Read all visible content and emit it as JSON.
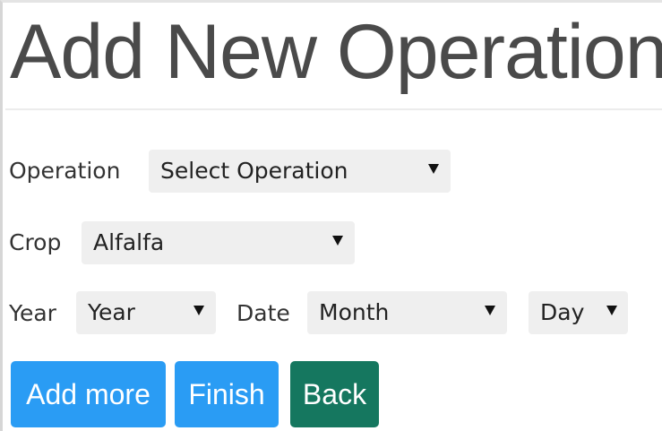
{
  "page": {
    "title": "Add New Operation"
  },
  "form": {
    "operation": {
      "label": "Operation",
      "selected": "Select Operation"
    },
    "crop": {
      "label": "Crop",
      "selected": "Alfalfa"
    },
    "year": {
      "label": "Year",
      "selected": "Year"
    },
    "date": {
      "label": "Date",
      "month_selected": "Month",
      "day_selected": "Day"
    }
  },
  "buttons": {
    "add_more": "Add more",
    "finish": "Finish",
    "back": "Back"
  },
  "colors": {
    "primary_button": "#2a9cf4",
    "back_button": "#15775f",
    "select_background": "#efefef",
    "title_text": "#4a4a4a"
  },
  "icons": {
    "dropdown": "triangle-down-icon"
  }
}
